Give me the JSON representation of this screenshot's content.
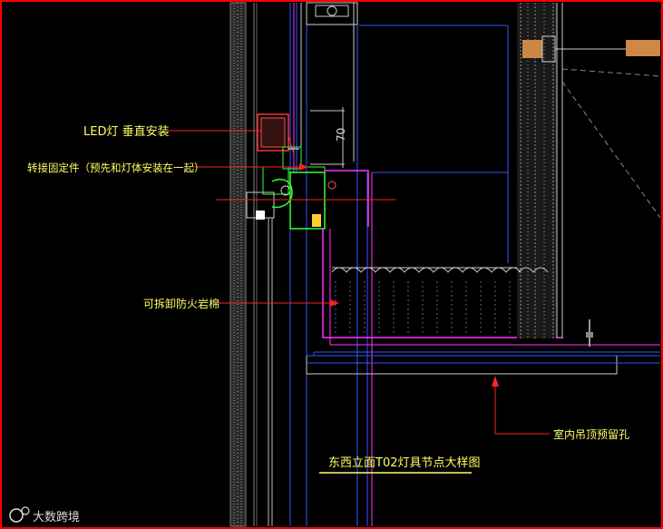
{
  "drawing": {
    "title": "东西立面T02灯具节点大样图",
    "dimension": "70",
    "callouts": {
      "led": "LED灯 垂直安装",
      "bracket": "转接固定件（预先和灯体安装在一起）",
      "rockwool": "可拆卸防火岩棉",
      "ceiling_hole": "室内吊顶预留孔"
    }
  },
  "watermark": {
    "brand": "大数跨境"
  },
  "colors": {
    "background": "#000000",
    "frame": "#ff0000",
    "label": "#ffff66",
    "blue": "#3355ff",
    "magenta": "#ff33ff",
    "green": "#33ff33",
    "white": "#e8e8e8",
    "red": "#ff2222"
  }
}
